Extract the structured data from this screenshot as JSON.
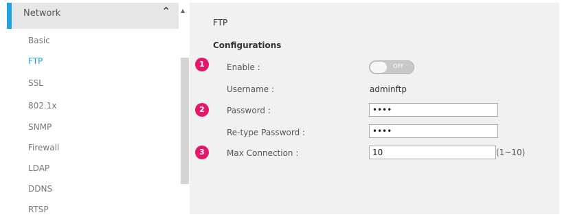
{
  "sidebar": {
    "header": "Network",
    "items": [
      {
        "label": "Basic"
      },
      {
        "label": "FTP"
      },
      {
        "label": "SSL"
      },
      {
        "label": "802.1x"
      },
      {
        "label": "SNMP"
      },
      {
        "label": "Firewall"
      },
      {
        "label": "LDAP"
      },
      {
        "label": "DDNS"
      },
      {
        "label": "RTSP"
      }
    ],
    "active_item": "FTP",
    "accent_color": "#1fa3dc"
  },
  "main": {
    "title": "FTP",
    "section": "Configurations",
    "badges": [
      "1",
      "2",
      "3"
    ],
    "badge_color": "#e5176b",
    "enable": {
      "label": "Enable :",
      "state": "OFF"
    },
    "username": {
      "label": "Username :",
      "value": "adminftp"
    },
    "password": {
      "label": "Password :",
      "value": "••••"
    },
    "retype_password": {
      "label": "Re-type Password :",
      "value": "••••"
    },
    "max_connection": {
      "label": "Max Connection :",
      "value": "10",
      "hint": "(1~10)"
    }
  },
  "icons": {
    "collapse": "chevron-up-icon",
    "scroll_up": "arrow-up-icon"
  }
}
